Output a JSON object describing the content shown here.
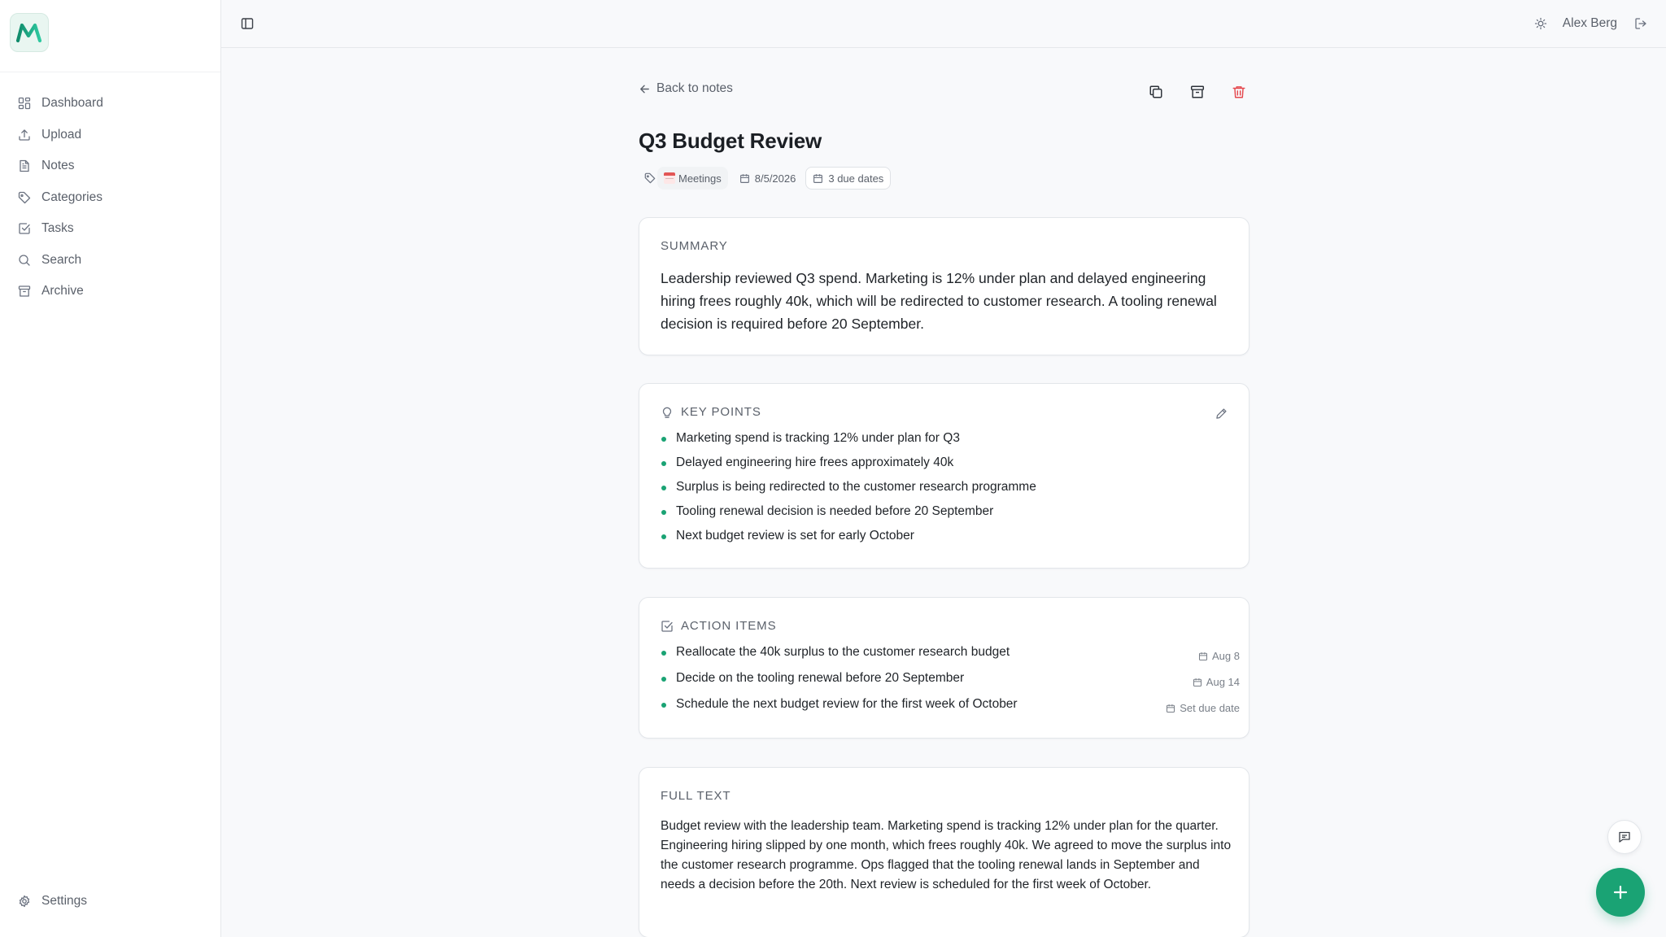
{
  "app": {
    "logo_letter": "M"
  },
  "sidebar": {
    "items": [
      {
        "label": "Dashboard",
        "icon": "dashboard-icon"
      },
      {
        "label": "Upload",
        "icon": "upload-icon"
      },
      {
        "label": "Notes",
        "icon": "notes-icon"
      },
      {
        "label": "Categories",
        "icon": "tag-icon"
      },
      {
        "label": "Tasks",
        "icon": "tasks-icon"
      },
      {
        "label": "Search",
        "icon": "search-icon"
      },
      {
        "label": "Archive",
        "icon": "archive-icon"
      }
    ],
    "settings_label": "Settings"
  },
  "topbar": {
    "user_name": "Alex Berg"
  },
  "note": {
    "back_label": "Back to notes",
    "title": "Q3 Budget Review",
    "category": "Meetings",
    "date": "8/5/2026",
    "due_dates_label": "3 due dates",
    "summary": {
      "heading": "SUMMARY",
      "text": "Leadership reviewed Q3 spend. Marketing is 12% under plan and delayed engineering hiring frees roughly 40k, which will be redirected to customer research. A tooling renewal decision is required before 20 September."
    },
    "key_points": {
      "heading": "KEY POINTS",
      "items": [
        "Marketing spend is tracking 12% under plan for Q3",
        "Delayed engineering hire frees approximately 40k",
        "Surplus is being redirected to the customer research programme",
        "Tooling renewal decision is needed before 20 September",
        "Next budget review is set for early October"
      ]
    },
    "action_items": {
      "heading": "ACTION ITEMS",
      "items": [
        {
          "text": "Reallocate the 40k surplus to the customer research budget",
          "due": "Aug 8"
        },
        {
          "text": "Decide on the tooling renewal before 20 September",
          "due": "Aug 14"
        },
        {
          "text": "Schedule the next budget review for the first week of October",
          "due": "Set due date"
        }
      ]
    },
    "full_text": {
      "heading": "FULL TEXT",
      "text": "Budget review with the leadership team. Marketing spend is tracking 12% under plan for the quarter. Engineering hiring slipped by one month, which frees roughly 40k. We agreed to move the surplus into the customer research programme. Ops flagged that the tooling renewal lands in September and needs a decision before the 20th. Next review is scheduled for the first week of October."
    }
  },
  "colors": {
    "accent": "#1aa374",
    "danger": "#e5484d",
    "muted": "#5b616b"
  }
}
